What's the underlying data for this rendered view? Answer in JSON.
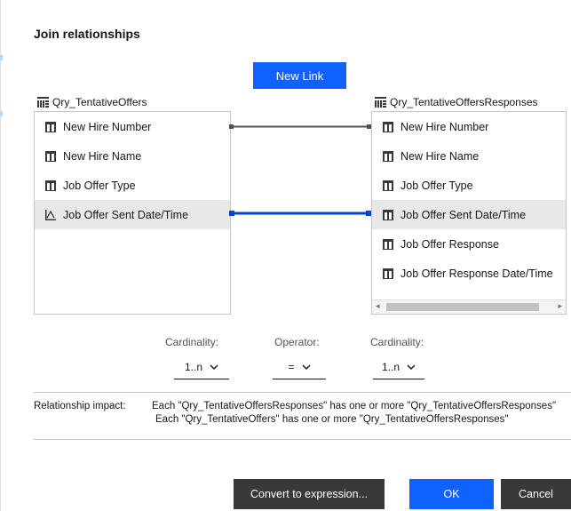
{
  "dialog": {
    "title": "Join relationships",
    "new_link_label": "New Link"
  },
  "left_table": {
    "name": "Qry_TentativeOffers",
    "columns": [
      {
        "label": "New Hire Number",
        "icon": "column-icon"
      },
      {
        "label": "New Hire Name",
        "icon": "column-icon"
      },
      {
        "label": "Job Offer Type",
        "icon": "column-icon"
      },
      {
        "label": "Job Offer Sent Date/Time",
        "icon": "timestamp-icon",
        "selected": true
      }
    ]
  },
  "right_table": {
    "name": "Qry_TentativeOffersResponses",
    "columns": [
      {
        "label": "New Hire Number",
        "icon": "column-icon"
      },
      {
        "label": "New Hire Name",
        "icon": "column-icon"
      },
      {
        "label": "Job Offer Type",
        "icon": "column-icon"
      },
      {
        "label": "Job Offer Sent Date/Time",
        "icon": "column-icon",
        "selected": true
      },
      {
        "label": "Job Offer Response",
        "icon": "column-icon"
      },
      {
        "label": "Job Offer Response Date/Time",
        "icon": "column-icon"
      }
    ]
  },
  "links": [
    {
      "from": "New Hire Number",
      "to": "New Hire Number",
      "color": "#525252",
      "selected": false
    },
    {
      "from": "Job Offer Sent Date/Time",
      "to": "Job Offer Sent Date/Time",
      "color": "#0043ce",
      "selected": true
    }
  ],
  "controls": {
    "left_cardinality_label": "Cardinality:",
    "left_cardinality_value": "1..n",
    "operator_label": "Operator:",
    "operator_value": "=",
    "right_cardinality_label": "Cardinality:",
    "right_cardinality_value": "1..n"
  },
  "impact": {
    "label": "Relationship impact:",
    "line1": "Each \"Qry_TentativeOffersResponses\" has one or more \"Qry_TentativeOffersResponses\"",
    "line2": "Each \"Qry_TentativeOffers\" has one or more \"Qry_TentativeOffersResponses\""
  },
  "buttons": {
    "convert": "Convert to expression...",
    "ok": "OK",
    "cancel": "Cancel"
  },
  "colors": {
    "primary": "#0f62fe",
    "selected_link": "#0043ce",
    "link": "#525252",
    "secondary_button": "#393939",
    "selected_row": "#e8e8e8"
  }
}
